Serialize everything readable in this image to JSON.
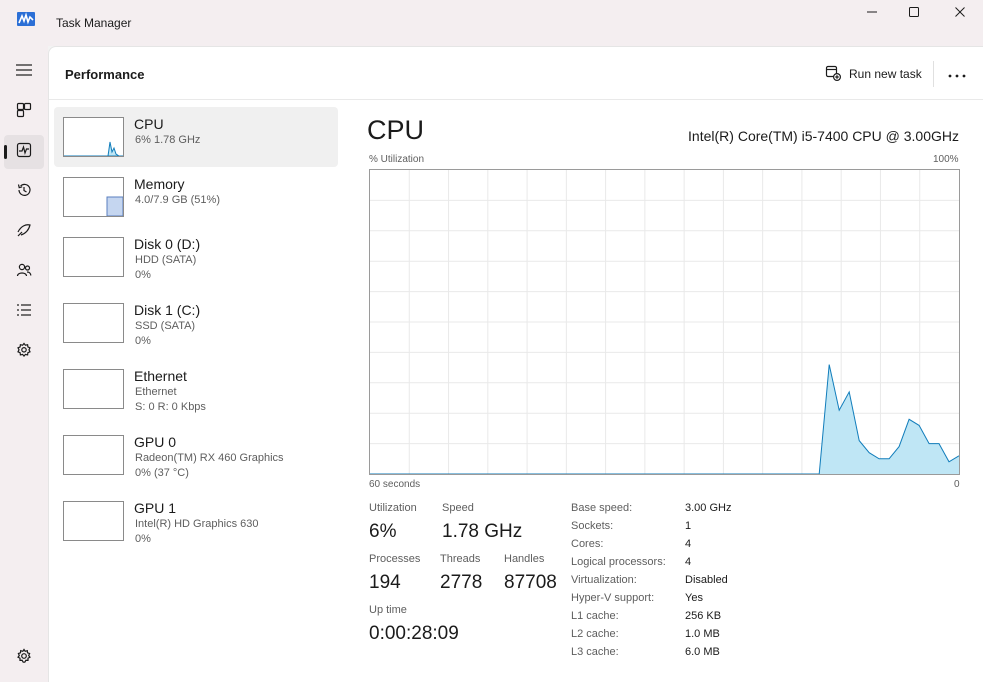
{
  "window": {
    "title": "Task Manager"
  },
  "header": {
    "title": "Performance",
    "run_new_task": "Run new task"
  },
  "rail": {
    "items": [
      {
        "icon": "hamburger-menu-icon"
      },
      {
        "icon": "processes-icon"
      },
      {
        "icon": "performance-icon",
        "active": true
      },
      {
        "icon": "app-history-icon"
      },
      {
        "icon": "startup-apps-icon"
      },
      {
        "icon": "users-icon"
      },
      {
        "icon": "details-icon"
      },
      {
        "icon": "services-icon"
      },
      {
        "icon": "settings-icon"
      }
    ]
  },
  "resources": [
    {
      "name": "CPU",
      "line1": "6%  1.78 GHz",
      "line2": "",
      "selected": true
    },
    {
      "name": "Memory",
      "line1": "4.0/7.9 GB (51%)",
      "line2": ""
    },
    {
      "name": "Disk 0 (D:)",
      "line1": "HDD (SATA)",
      "line2": "0%"
    },
    {
      "name": "Disk 1 (C:)",
      "line1": "SSD (SATA)",
      "line2": "0%"
    },
    {
      "name": "Ethernet",
      "line1": "Ethernet",
      "line2": "S: 0  R: 0 Kbps"
    },
    {
      "name": "GPU 0",
      "line1": "Radeon(TM) RX 460 Graphics",
      "line2": "0% (37 °C)"
    },
    {
      "name": "GPU 1",
      "line1": "Intel(R) HD Graphics 630",
      "line2": "0%"
    }
  ],
  "main": {
    "title": "CPU",
    "model": "Intel(R) Core(TM) i5-7400 CPU @ 3.00GHz",
    "utilization_label": "% Utilization",
    "max_label": "100%",
    "time_label": "60 seconds",
    "min_label": "0"
  },
  "stats": {
    "utilization_label": "Utilization",
    "utilization": "6%",
    "speed_label": "Speed",
    "speed": "1.78 GHz",
    "processes_label": "Processes",
    "processes": "194",
    "threads_label": "Threads",
    "threads": "2778",
    "handles_label": "Handles",
    "handles": "87708",
    "uptime_label": "Up time",
    "uptime": "0:00:28:09"
  },
  "specs": [
    {
      "key": "Base speed:",
      "value": "3.00 GHz"
    },
    {
      "key": "Sockets:",
      "value": "1"
    },
    {
      "key": "Cores:",
      "value": "4"
    },
    {
      "key": "Logical processors:",
      "value": "4"
    },
    {
      "key": "Virtualization:",
      "value": "Disabled"
    },
    {
      "key": "Hyper-V support:",
      "value": "Yes"
    },
    {
      "key": "L1 cache:",
      "value": "256 KB"
    },
    {
      "key": "L2 cache:",
      "value": "1.0 MB"
    },
    {
      "key": "L3 cache:",
      "value": "6.0 MB"
    }
  ],
  "cpu_history": [
    0,
    0,
    0,
    0,
    0,
    0,
    0,
    0,
    0,
    0,
    0,
    0,
    0,
    0,
    0,
    0,
    0,
    0,
    0,
    0,
    0,
    0,
    0,
    0,
    0,
    0,
    0,
    0,
    0,
    0,
    0,
    0,
    0,
    0,
    0,
    0,
    0,
    0,
    0,
    0,
    0,
    0,
    0,
    0,
    0,
    0,
    36,
    21,
    27,
    11,
    7,
    5,
    5,
    9,
    18,
    16,
    10,
    10,
    4,
    6
  ],
  "colors": {
    "accent": "#117dbb",
    "fill": "#bfe6f5",
    "grid": "#e9e9e9"
  }
}
